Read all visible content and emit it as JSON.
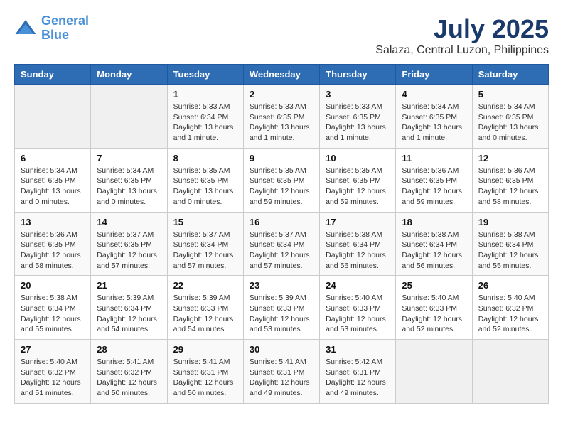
{
  "logo": {
    "line1": "General",
    "line2": "Blue"
  },
  "title": "July 2025",
  "subtitle": "Salaza, Central Luzon, Philippines",
  "weekdays": [
    "Sunday",
    "Monday",
    "Tuesday",
    "Wednesday",
    "Thursday",
    "Friday",
    "Saturday"
  ],
  "weeks": [
    [
      {
        "day": "",
        "info": ""
      },
      {
        "day": "",
        "info": ""
      },
      {
        "day": "1",
        "info": "Sunrise: 5:33 AM\nSunset: 6:34 PM\nDaylight: 13 hours\nand 1 minute."
      },
      {
        "day": "2",
        "info": "Sunrise: 5:33 AM\nSunset: 6:35 PM\nDaylight: 13 hours\nand 1 minute."
      },
      {
        "day": "3",
        "info": "Sunrise: 5:33 AM\nSunset: 6:35 PM\nDaylight: 13 hours\nand 1 minute."
      },
      {
        "day": "4",
        "info": "Sunrise: 5:34 AM\nSunset: 6:35 PM\nDaylight: 13 hours\nand 1 minute."
      },
      {
        "day": "5",
        "info": "Sunrise: 5:34 AM\nSunset: 6:35 PM\nDaylight: 13 hours\nand 0 minutes."
      }
    ],
    [
      {
        "day": "6",
        "info": "Sunrise: 5:34 AM\nSunset: 6:35 PM\nDaylight: 13 hours\nand 0 minutes."
      },
      {
        "day": "7",
        "info": "Sunrise: 5:34 AM\nSunset: 6:35 PM\nDaylight: 13 hours\nand 0 minutes."
      },
      {
        "day": "8",
        "info": "Sunrise: 5:35 AM\nSunset: 6:35 PM\nDaylight: 13 hours\nand 0 minutes."
      },
      {
        "day": "9",
        "info": "Sunrise: 5:35 AM\nSunset: 6:35 PM\nDaylight: 12 hours\nand 59 minutes."
      },
      {
        "day": "10",
        "info": "Sunrise: 5:35 AM\nSunset: 6:35 PM\nDaylight: 12 hours\nand 59 minutes."
      },
      {
        "day": "11",
        "info": "Sunrise: 5:36 AM\nSunset: 6:35 PM\nDaylight: 12 hours\nand 59 minutes."
      },
      {
        "day": "12",
        "info": "Sunrise: 5:36 AM\nSunset: 6:35 PM\nDaylight: 12 hours\nand 58 minutes."
      }
    ],
    [
      {
        "day": "13",
        "info": "Sunrise: 5:36 AM\nSunset: 6:35 PM\nDaylight: 12 hours\nand 58 minutes."
      },
      {
        "day": "14",
        "info": "Sunrise: 5:37 AM\nSunset: 6:35 PM\nDaylight: 12 hours\nand 57 minutes."
      },
      {
        "day": "15",
        "info": "Sunrise: 5:37 AM\nSunset: 6:34 PM\nDaylight: 12 hours\nand 57 minutes."
      },
      {
        "day": "16",
        "info": "Sunrise: 5:37 AM\nSunset: 6:34 PM\nDaylight: 12 hours\nand 57 minutes."
      },
      {
        "day": "17",
        "info": "Sunrise: 5:38 AM\nSunset: 6:34 PM\nDaylight: 12 hours\nand 56 minutes."
      },
      {
        "day": "18",
        "info": "Sunrise: 5:38 AM\nSunset: 6:34 PM\nDaylight: 12 hours\nand 56 minutes."
      },
      {
        "day": "19",
        "info": "Sunrise: 5:38 AM\nSunset: 6:34 PM\nDaylight: 12 hours\nand 55 minutes."
      }
    ],
    [
      {
        "day": "20",
        "info": "Sunrise: 5:38 AM\nSunset: 6:34 PM\nDaylight: 12 hours\nand 55 minutes."
      },
      {
        "day": "21",
        "info": "Sunrise: 5:39 AM\nSunset: 6:34 PM\nDaylight: 12 hours\nand 54 minutes."
      },
      {
        "day": "22",
        "info": "Sunrise: 5:39 AM\nSunset: 6:33 PM\nDaylight: 12 hours\nand 54 minutes."
      },
      {
        "day": "23",
        "info": "Sunrise: 5:39 AM\nSunset: 6:33 PM\nDaylight: 12 hours\nand 53 minutes."
      },
      {
        "day": "24",
        "info": "Sunrise: 5:40 AM\nSunset: 6:33 PM\nDaylight: 12 hours\nand 53 minutes."
      },
      {
        "day": "25",
        "info": "Sunrise: 5:40 AM\nSunset: 6:33 PM\nDaylight: 12 hours\nand 52 minutes."
      },
      {
        "day": "26",
        "info": "Sunrise: 5:40 AM\nSunset: 6:32 PM\nDaylight: 12 hours\nand 52 minutes."
      }
    ],
    [
      {
        "day": "27",
        "info": "Sunrise: 5:40 AM\nSunset: 6:32 PM\nDaylight: 12 hours\nand 51 minutes."
      },
      {
        "day": "28",
        "info": "Sunrise: 5:41 AM\nSunset: 6:32 PM\nDaylight: 12 hours\nand 50 minutes."
      },
      {
        "day": "29",
        "info": "Sunrise: 5:41 AM\nSunset: 6:31 PM\nDaylight: 12 hours\nand 50 minutes."
      },
      {
        "day": "30",
        "info": "Sunrise: 5:41 AM\nSunset: 6:31 PM\nDaylight: 12 hours\nand 49 minutes."
      },
      {
        "day": "31",
        "info": "Sunrise: 5:42 AM\nSunset: 6:31 PM\nDaylight: 12 hours\nand 49 minutes."
      },
      {
        "day": "",
        "info": ""
      },
      {
        "day": "",
        "info": ""
      }
    ]
  ]
}
